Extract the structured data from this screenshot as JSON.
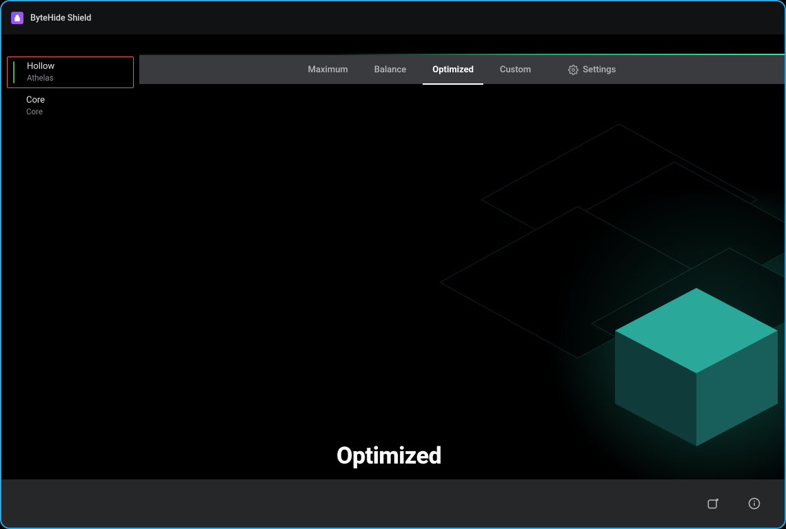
{
  "header": {
    "title": "ByteHide Shield"
  },
  "sidebar": {
    "items": [
      {
        "label": "Hollow",
        "sublabel": "Athelas",
        "active": true
      },
      {
        "label": "Core",
        "sublabel": "Core",
        "active": false
      }
    ]
  },
  "tabs": {
    "items": [
      {
        "label": "Maximum",
        "active": false
      },
      {
        "label": "Balance",
        "active": false
      },
      {
        "label": "Optimized",
        "active": true
      },
      {
        "label": "Custom",
        "active": false
      }
    ],
    "settings_label": "Settings"
  },
  "main": {
    "heading": "Optimized"
  },
  "footer": {
    "icons": {
      "window": "window-icon",
      "info": "info-icon"
    }
  },
  "colors": {
    "frame_border": "#29a9e0",
    "accent_green": "#3be48a",
    "highlight_border": "#e85a4f",
    "tabbar_bg": "#3a3b3e",
    "footer_bg": "#262729"
  }
}
